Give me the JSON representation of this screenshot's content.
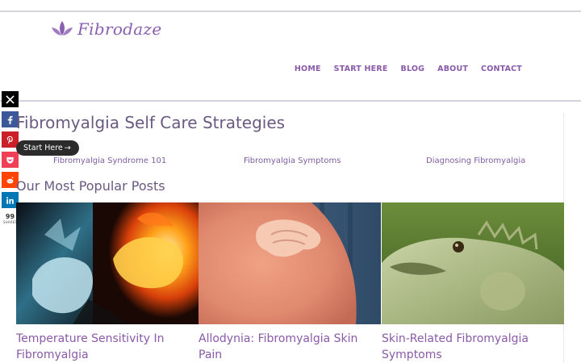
{
  "brand": {
    "name": "Fibrodaze"
  },
  "nav": [
    "HOME",
    "START HERE",
    "BLOG",
    "ABOUT",
    "CONTACT"
  ],
  "social": {
    "buttons": [
      {
        "name": "x",
        "glyph": "X",
        "color": "#000000"
      },
      {
        "name": "facebook",
        "glyph": "f",
        "color": "#3b5998"
      },
      {
        "name": "pinterest",
        "glyph": "P",
        "color": "#cb2027"
      },
      {
        "name": "pocket",
        "glyph": "pocket",
        "color": "#ef4056"
      },
      {
        "name": "reddit",
        "glyph": "reddit",
        "color": "#ff4500"
      },
      {
        "name": "linkedin",
        "glyph": "in",
        "color": "#0077b5"
      }
    ],
    "count": "99",
    "count_label": "SHARES"
  },
  "page": {
    "title": "Fibromyalgia Self Care Strategies",
    "start_pill": "Start Here",
    "start_arrow": "→",
    "links": [
      "Fibromyalgia Syndrome 101",
      "Fibromyalgia Symptoms",
      "Diagnosing Fibromyalgia"
    ],
    "popular_title": "Our Most Popular Posts",
    "posts": [
      {
        "title": "Temperature Sensitivity In Fibromyalgia",
        "image": "fire-and-ice-fists"
      },
      {
        "title": "Allodynia: Fibromyalgia Skin Pain",
        "image": "sunburned-shoulder"
      },
      {
        "title": "Skin-Related Fibromyalgia Symptoms",
        "image": "iguana"
      }
    ]
  },
  "colors": {
    "accent": "#8a5aa8",
    "heading": "#6a5a82",
    "rule": "#d6cfe0"
  }
}
